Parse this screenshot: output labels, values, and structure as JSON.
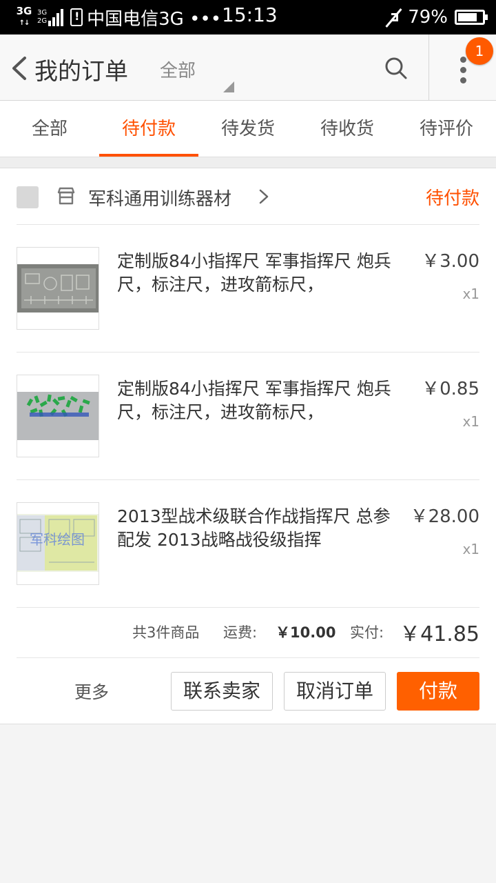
{
  "status_bar": {
    "net_type_1": "3G",
    "net_type_2a": "3G",
    "net_type_2b": "2G",
    "carrier": "中国电信3G •••",
    "time": "15:13",
    "battery_percent": "79%",
    "battery_level": 0.79
  },
  "header": {
    "title": "我的订单",
    "filter_label": "全部",
    "notification_count": "1"
  },
  "tabs": [
    {
      "label": "全部",
      "active": false
    },
    {
      "label": "待付款",
      "active": true
    },
    {
      "label": "待发货",
      "active": false
    },
    {
      "label": "待收货",
      "active": false
    },
    {
      "label": "待评价",
      "active": false
    }
  ],
  "order": {
    "shop_name": "军科通用训练器材",
    "status": "待付款",
    "items": [
      {
        "title": "定制版84小指挥尺 军事指挥尺 炮兵尺，标注尺，进攻箭标尺，",
        "price": "￥3.00",
        "qty": "x1",
        "thumb_icon": "ruler-image"
      },
      {
        "title": "定制版84小指挥尺 军事指挥尺 炮兵尺，标注尺，进攻箭标尺，",
        "price": "￥0.85",
        "qty": "x1",
        "thumb_icon": "green-markers-image"
      },
      {
        "title": "2013型战术级联合作战指挥尺 总参配发 2013战略战役级指挥",
        "price": "￥28.00",
        "qty": "x1",
        "thumb_icon": "tactical-ruler-image",
        "thumb_text": "军科绘图"
      }
    ],
    "summary": {
      "count_text": "共3件商品",
      "shipping_label": "运费:",
      "shipping_value": "￥10.00",
      "paid_label": "实付:",
      "paid_value": "￥41.85"
    },
    "actions": {
      "more": "更多",
      "contact": "联系卖家",
      "cancel": "取消订单",
      "pay": "付款"
    }
  },
  "colors": {
    "accent": "#ff5000",
    "pay_button": "#ff6000",
    "badge": "#ff5a00"
  }
}
